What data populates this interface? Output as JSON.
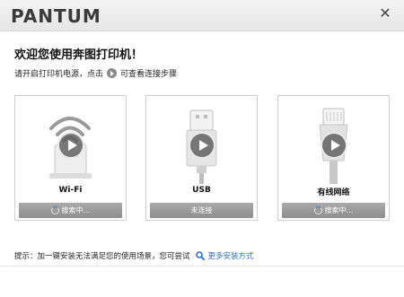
{
  "window": {
    "brand": "PANTUM",
    "close_icon": "close-icon"
  },
  "welcome": {
    "title": "欢迎您使用奔图打印机！",
    "instruction_before": "请开启打印机电源，点击",
    "instruction_after": "可查看连接步骤"
  },
  "cards": [
    {
      "label": "Wi-Fi",
      "status": "搜索中…",
      "searching": true,
      "icon": "wifi-router-icon"
    },
    {
      "label": "USB",
      "status": "未连接",
      "searching": false,
      "icon": "usb-cable-icon"
    },
    {
      "label": "有线网络",
      "status": "搜索中…",
      "searching": true,
      "icon": "ethernet-cable-icon"
    }
  ],
  "footer": {
    "hint": "提示：加一键安装无法满足您的使用场景，您可尝试",
    "link": "更多安装方式"
  },
  "colors": {
    "status_bar": "#8d8d8d",
    "link": "#2a6fd0",
    "spinner": "#3b7bd5"
  }
}
